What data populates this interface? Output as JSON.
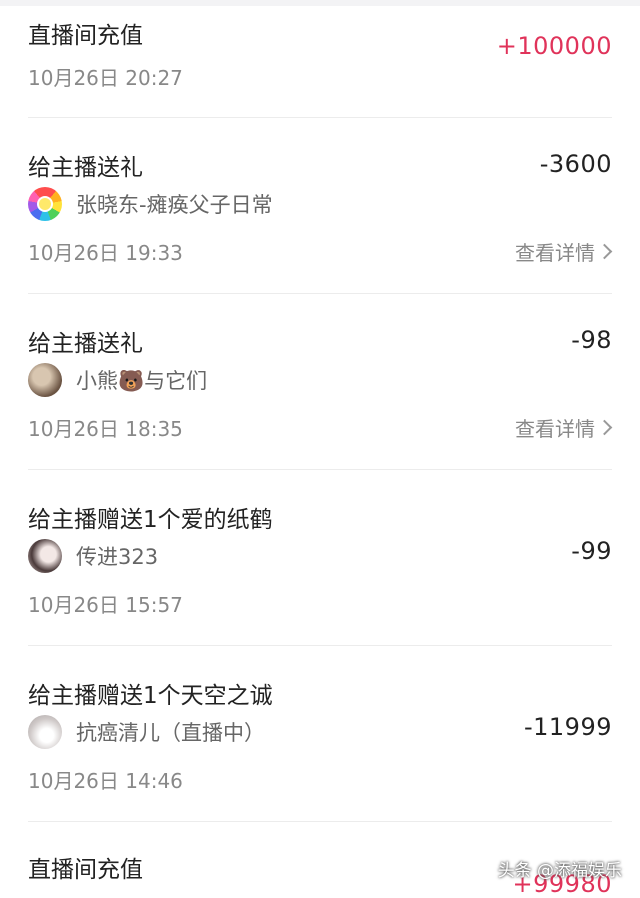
{
  "records": [
    {
      "title": "直播间充值",
      "amount": "+100000",
      "time": "10月26日 20:27"
    },
    {
      "title": "给主播送礼",
      "amount": "-3600",
      "streamer": "张晓东-瘫痪父子日常",
      "time": "10月26日 19:33",
      "detail": "查看详情"
    },
    {
      "title": "给主播送礼",
      "amount": "-98",
      "streamer": "小熊🐻与它们",
      "time": "10月26日 18:35",
      "detail": "查看详情"
    },
    {
      "title": "给主播赠送1个爱的纸鹤",
      "amount": "-99",
      "streamer": "传进323",
      "time": "10月26日 15:57"
    },
    {
      "title": "给主播赠送1个天空之诚",
      "amount": "-11999",
      "streamer": "抗癌清儿（直播中）",
      "time": "10月26日 14:46"
    },
    {
      "title": "直播间充值",
      "amount": "+99980"
    }
  ],
  "watermark": "头条 @添福娱乐",
  "colors": {
    "positive_amount": "#e0335a",
    "negative_amount": "#222222",
    "secondary_text": "#888888"
  },
  "icons": [
    "flower-avatar",
    "bear-avatar",
    "girl-avatar",
    "portrait-avatar",
    "chevron-right-icon"
  ]
}
